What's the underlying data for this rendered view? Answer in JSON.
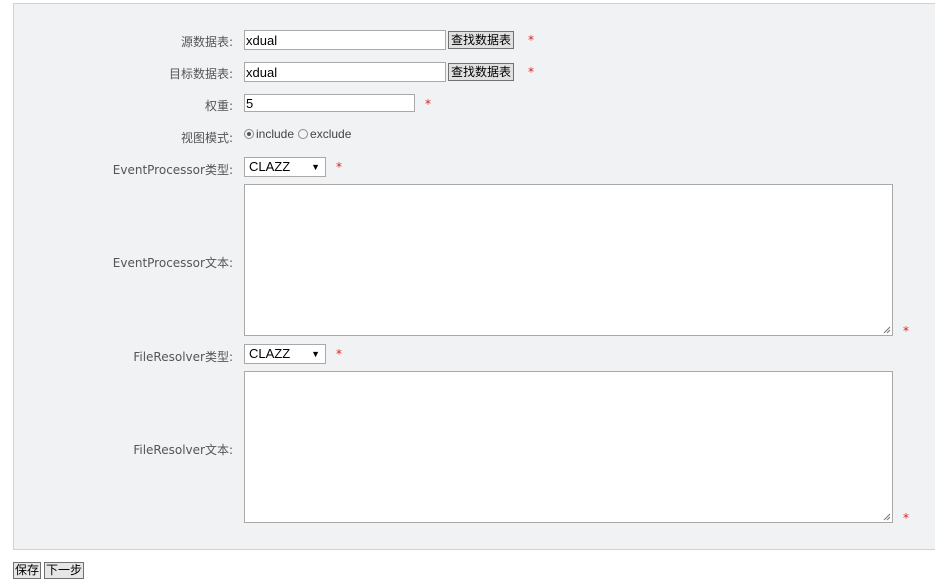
{
  "form": {
    "source_table": {
      "label": "源数据表:",
      "value": "xdual",
      "find_label": "查找数据表"
    },
    "target_table": {
      "label": "目标数据表:",
      "value": "xdual",
      "find_label": "查找数据表"
    },
    "weight": {
      "label": "权重:",
      "value": "5"
    },
    "view_mode": {
      "label": "视图模式:",
      "options": [
        "include",
        "exclude"
      ],
      "selected": "include"
    },
    "event_processor_type": {
      "label": "EventProcessor类型:",
      "value": "CLAZZ"
    },
    "event_processor_text": {
      "label": "EventProcessor文本:",
      "value": ""
    },
    "file_resolver_type": {
      "label": "FileResolver类型:",
      "value": "CLAZZ"
    },
    "file_resolver_text": {
      "label": "FileResolver文本:",
      "value": ""
    },
    "required_mark": "*"
  },
  "footer": {
    "save_label": "保存",
    "next_label": "下一步"
  },
  "colors": {
    "panel_bg": "#f1f2f3",
    "required": "#e02020",
    "button_bg": "#e1e1e1"
  }
}
